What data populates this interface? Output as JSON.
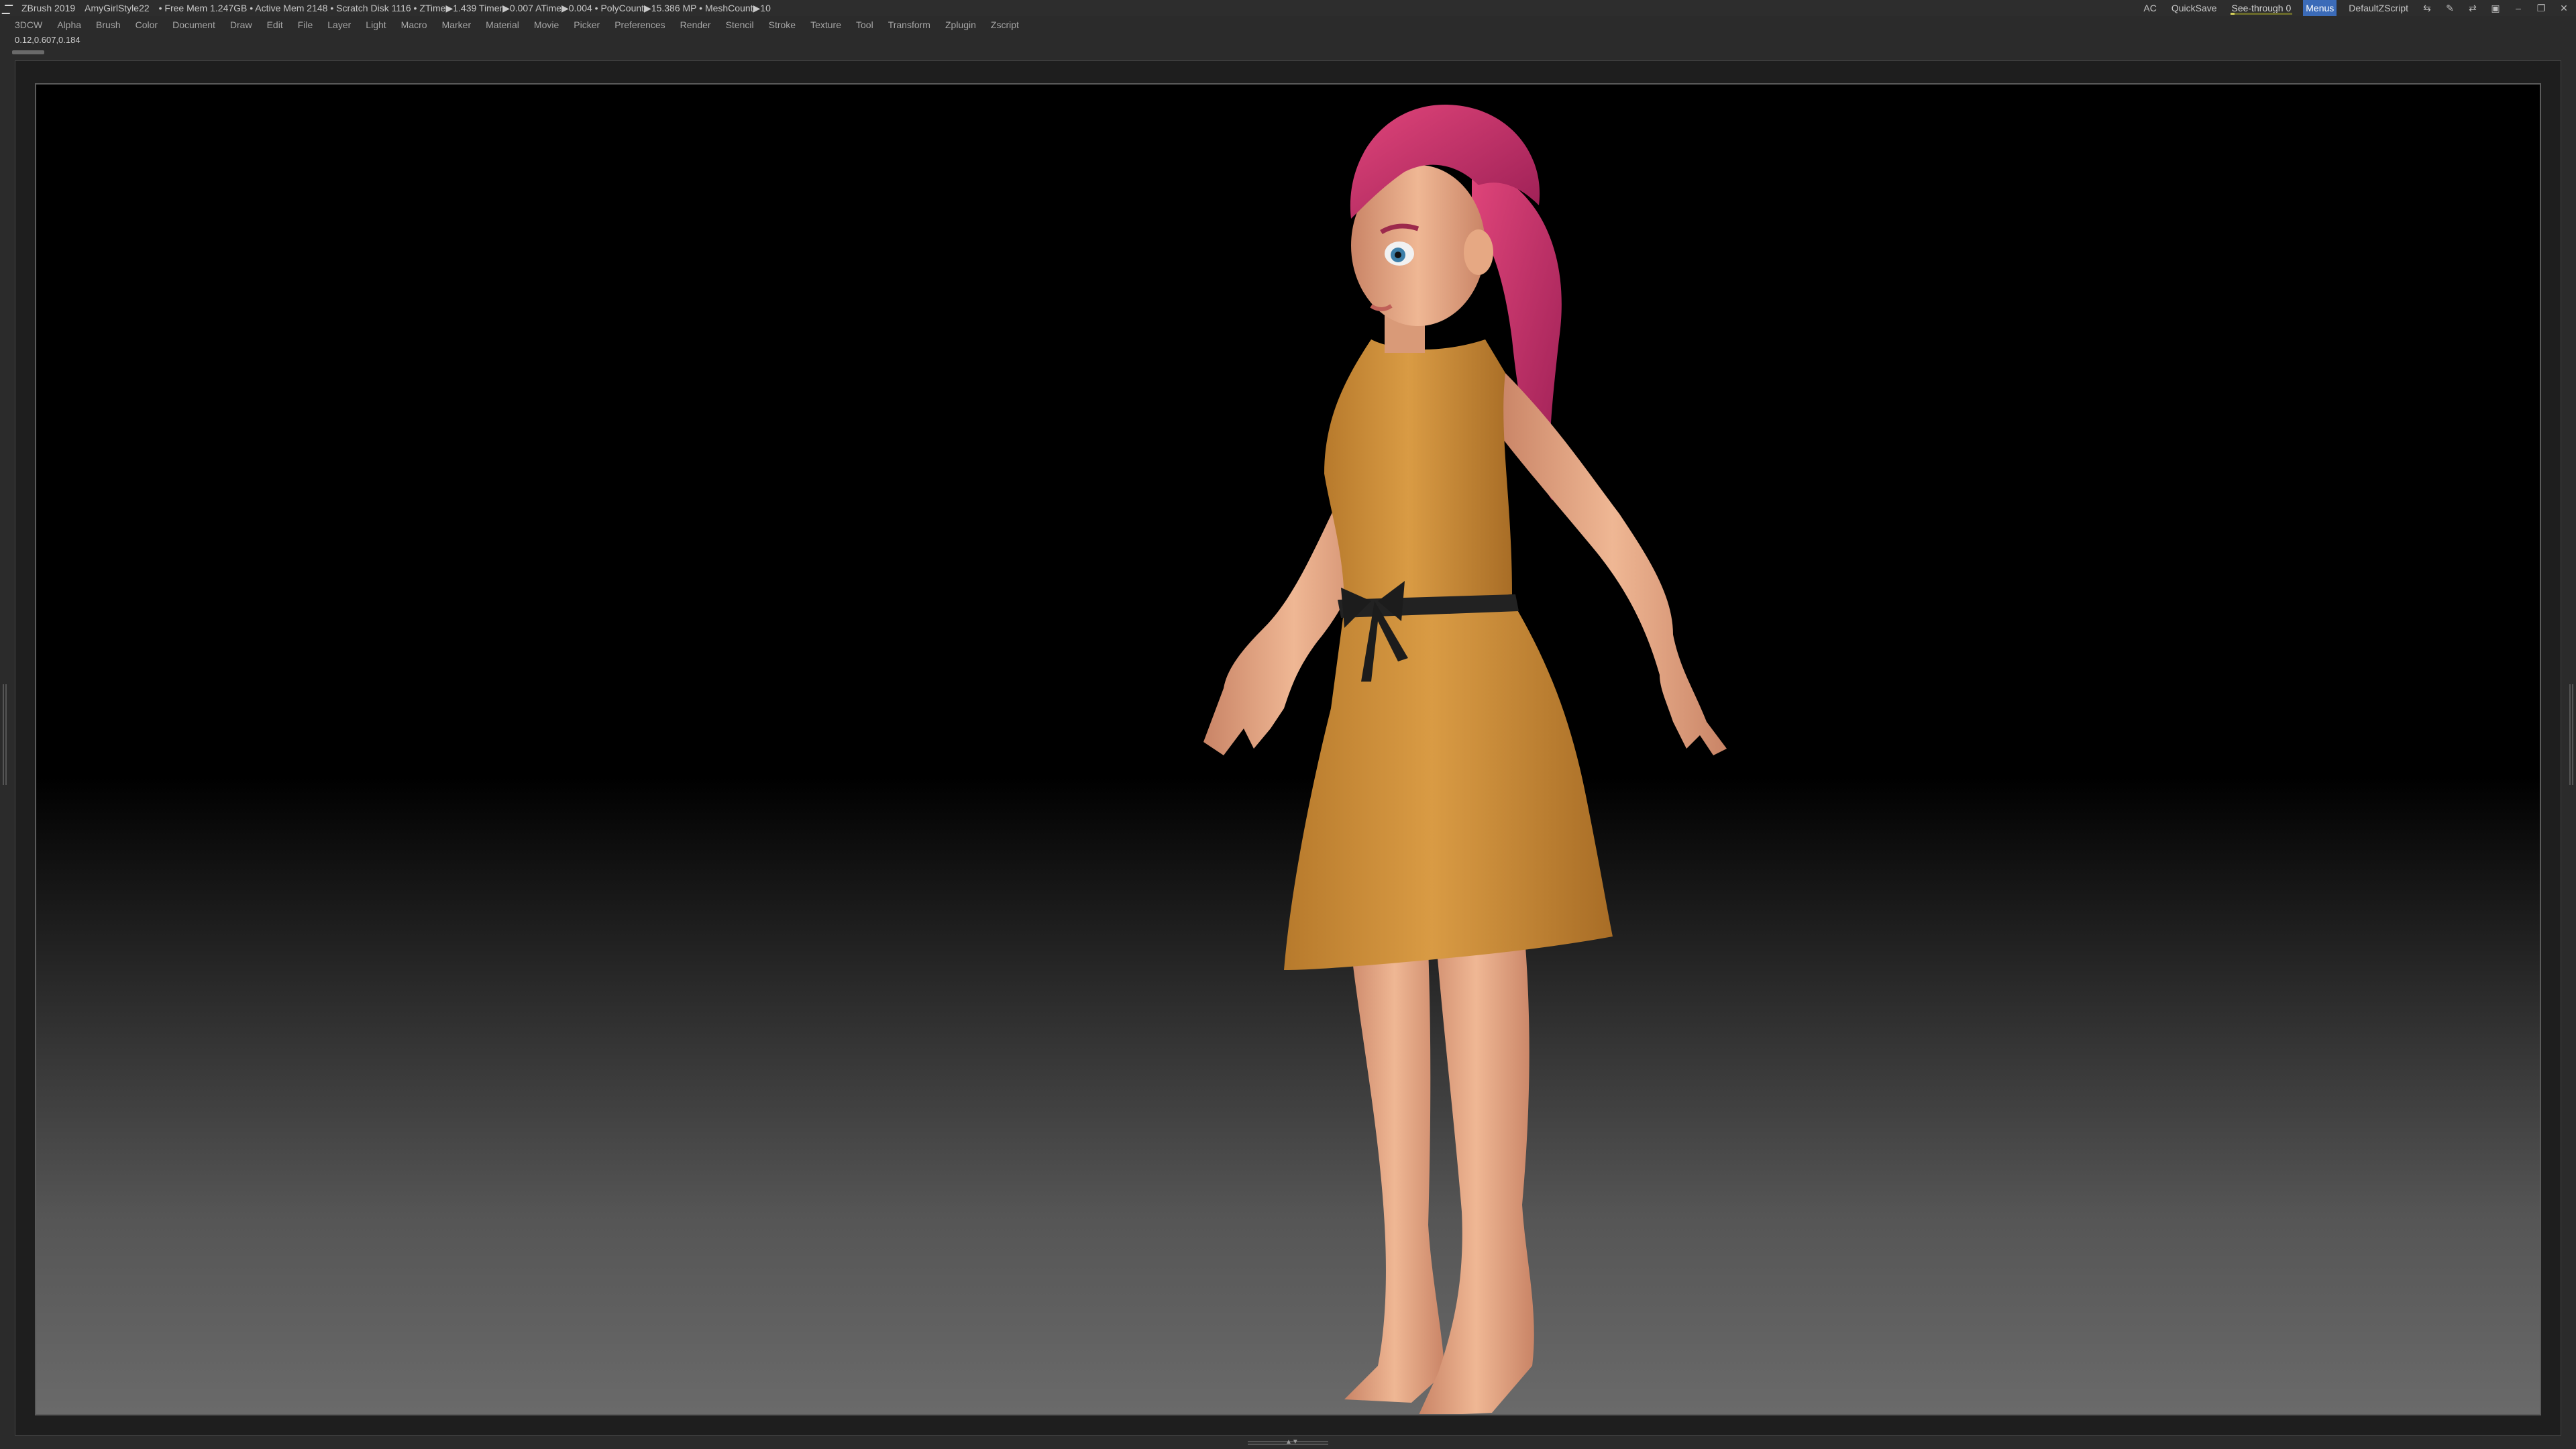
{
  "titlebar": {
    "app_title": "ZBrush 2019",
    "project": "AmyGirlStyle22",
    "stats": "• Free Mem 1.247GB • Active Mem 2148 • Scratch Disk 1116 • ZTime▶1.439 Timer▶0.007 ATime▶0.004 • PolyCount▶15.386 MP • MeshCount▶10",
    "ac": "AC",
    "quicksave": "QuickSave",
    "see_through": "See-through  0",
    "menus_btn": "Menus",
    "default_zscript": "DefaultZScript",
    "icons": [
      "layout-icon",
      "brush-icon",
      "swap-icon",
      "lock-icon",
      "minimize-icon",
      "restore-icon",
      "close-icon"
    ]
  },
  "menubar": {
    "items": [
      "3DCW",
      "Alpha",
      "Brush",
      "Color",
      "Document",
      "Draw",
      "Edit",
      "File",
      "Layer",
      "Light",
      "Macro",
      "Marker",
      "Material",
      "Movie",
      "Picker",
      "Preferences",
      "Render",
      "Stencil",
      "Stroke",
      "Texture",
      "Tool",
      "Transform",
      "Zplugin",
      "Zscript"
    ]
  },
  "info": {
    "coords": "0.12,0.607,0.184"
  },
  "colors": {
    "accent": "#3b6bb8",
    "dress": "#c98d3a",
    "hair": "#c0306a",
    "skin": "#e6a883",
    "belt": "#222222"
  }
}
